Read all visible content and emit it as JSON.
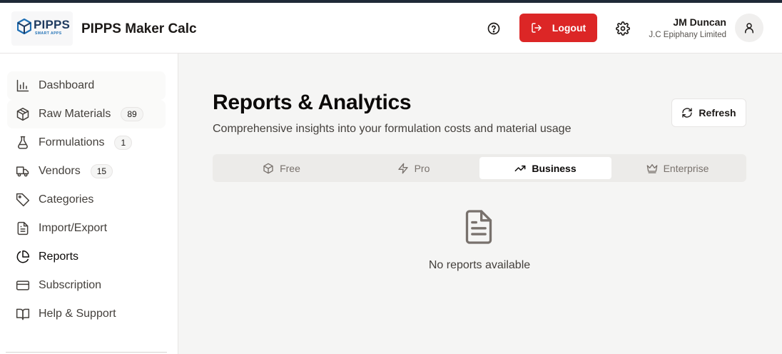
{
  "header": {
    "logo_text": "PIPPS",
    "logo_subtext": "SMART APPS",
    "app_title": "PIPPS Maker Calc",
    "logout_label": "Logout",
    "user_name": "JM Duncan",
    "user_org": "J.C Epiphany Limited"
  },
  "sidebar": {
    "items": [
      {
        "label": "Dashboard",
        "icon": "bar-chart-icon"
      },
      {
        "label": "Raw Materials",
        "icon": "package-icon",
        "badge": "89"
      },
      {
        "label": "Formulations",
        "icon": "flask-icon",
        "badge": "1"
      },
      {
        "label": "Vendors",
        "icon": "truck-icon",
        "badge": "15"
      },
      {
        "label": "Categories",
        "icon": "tag-icon"
      },
      {
        "label": "Import/Export",
        "icon": "file-text-icon"
      },
      {
        "label": "Reports",
        "icon": "pie-chart-icon"
      },
      {
        "label": "Subscription",
        "icon": "credit-card-icon"
      },
      {
        "label": "Help & Support",
        "icon": "book-icon"
      }
    ]
  },
  "main": {
    "title": "Reports & Analytics",
    "subtitle": "Comprehensive insights into your formulation costs and material usage",
    "refresh_label": "Refresh",
    "tabs": [
      {
        "label": "Free",
        "icon": "package-icon"
      },
      {
        "label": "Pro",
        "icon": "zap-icon"
      },
      {
        "label": "Business",
        "icon": "trending-up-icon"
      },
      {
        "label": "Enterprise",
        "icon": "crown-icon"
      }
    ],
    "active_tab": "Business",
    "empty_message": "No reports available"
  },
  "colors": {
    "accent_danger": "#dc2626",
    "brand_navy": "#1e3a5f",
    "text_primary": "#1c1917",
    "text_muted": "#78716c"
  }
}
